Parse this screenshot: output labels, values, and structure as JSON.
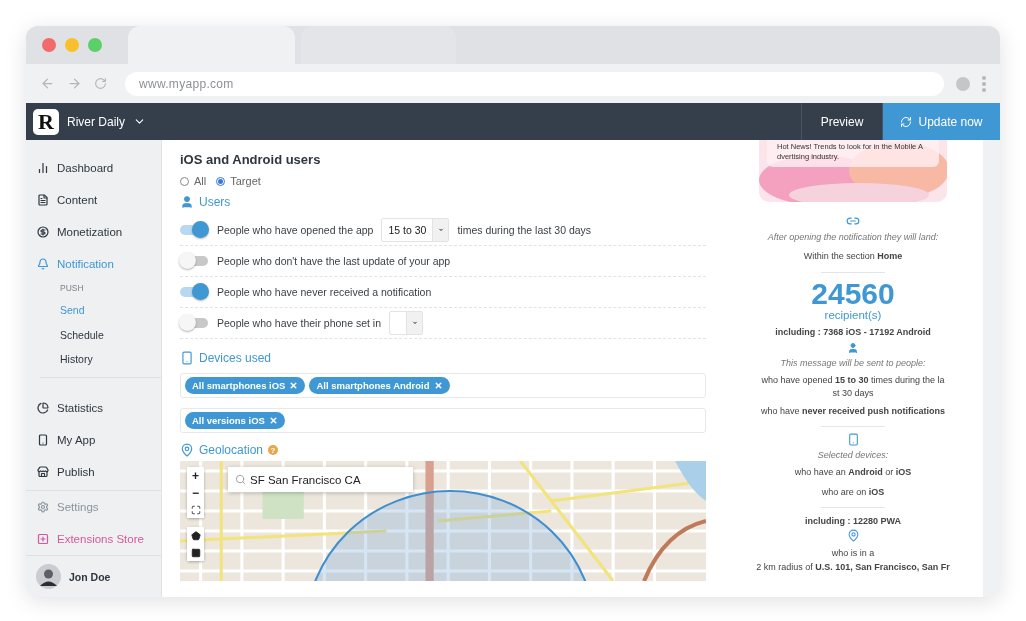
{
  "browser": {
    "url": "www.myapp.com"
  },
  "header": {
    "logo_letter": "R",
    "app_name": "River Daily",
    "buttons": [
      {
        "label": "Preview",
        "kind": "plain"
      },
      {
        "label": "Update now",
        "kind": "primary"
      }
    ]
  },
  "sidebar": {
    "items": [
      {
        "label": "Dashboard",
        "kind": "nav",
        "selected": false
      },
      {
        "label": "Content",
        "kind": "nav",
        "selected": false
      },
      {
        "label": "Monetization",
        "kind": "nav",
        "selected": false
      },
      {
        "label": "Notification",
        "kind": "nav",
        "selected": true,
        "section": "PUSH",
        "children": [
          {
            "label": "Send",
            "selected": true
          },
          {
            "label": "Schedule",
            "selected": false
          },
          {
            "label": "History",
            "selected": false
          }
        ]
      },
      {
        "label": "Statistics",
        "kind": "nav",
        "selected": false
      },
      {
        "label": "My App",
        "kind": "nav",
        "selected": false
      },
      {
        "label": "Publish",
        "kind": "nav",
        "selected": false
      },
      {
        "label": "Settings",
        "kind": "muted",
        "selected": false
      },
      {
        "label": "Extensions Store",
        "kind": "extension",
        "selected": false
      }
    ],
    "user": {
      "name": "Jon Doe"
    }
  },
  "audience": {
    "title": "iOS and Android users",
    "options": [
      {
        "label": "All",
        "selected": false
      },
      {
        "label": "Target",
        "selected": true
      }
    ]
  },
  "users": {
    "heading": "Users",
    "rules": [
      {
        "kind": "select",
        "on": true,
        "label": "People who have opened the app",
        "value": "15 to 30",
        "suffix": "times during the last 30 days"
      },
      {
        "kind": "plain",
        "on": false,
        "label": "People who don't have the last update of your app"
      },
      {
        "kind": "plain",
        "on": true,
        "label": "People who have never received a notification"
      },
      {
        "kind": "select",
        "on": false,
        "label": "People who have their phone set in"
      }
    ]
  },
  "devices": {
    "heading": "Devices used",
    "fields": [
      {
        "tags": [
          "All smartphones iOS",
          "All smartphones Android"
        ]
      },
      {
        "tags": [
          "All versions iOS"
        ]
      }
    ]
  },
  "geolocation": {
    "heading": "Geolocation",
    "help": "?",
    "map": {
      "search": "SF San Francisco CA",
      "zoom_in": "+",
      "zoom_out": "−"
    }
  },
  "summary": {
    "notification": "Hot News! Trends to look for in the Mobile A dvertising industry.",
    "landing": {
      "caption": "After opening the notification they will land:",
      "text": "Within the section **Home**"
    },
    "recipients": {
      "count": "24560",
      "unit": "recipient(s)",
      "breakdown": "including : 7368 iOS - 17192 Android"
    },
    "people": {
      "caption": "This message will be sent to people:",
      "lines": [
        "who have opened **15 to 30** times during the la st 30 days",
        "who have **never received push notifications**"
      ]
    },
    "devices": {
      "caption": "Selected devices:",
      "lines": [
        "who have an **Android** or **iOS**",
        "who are on **iOS**"
      ]
    },
    "pwa": "including : 12280 PWA",
    "location": {
      "lines": [
        "who is in a",
        "2 km radius of **U.S. 101, San Francisco, San Fr**"
      ]
    }
  }
}
